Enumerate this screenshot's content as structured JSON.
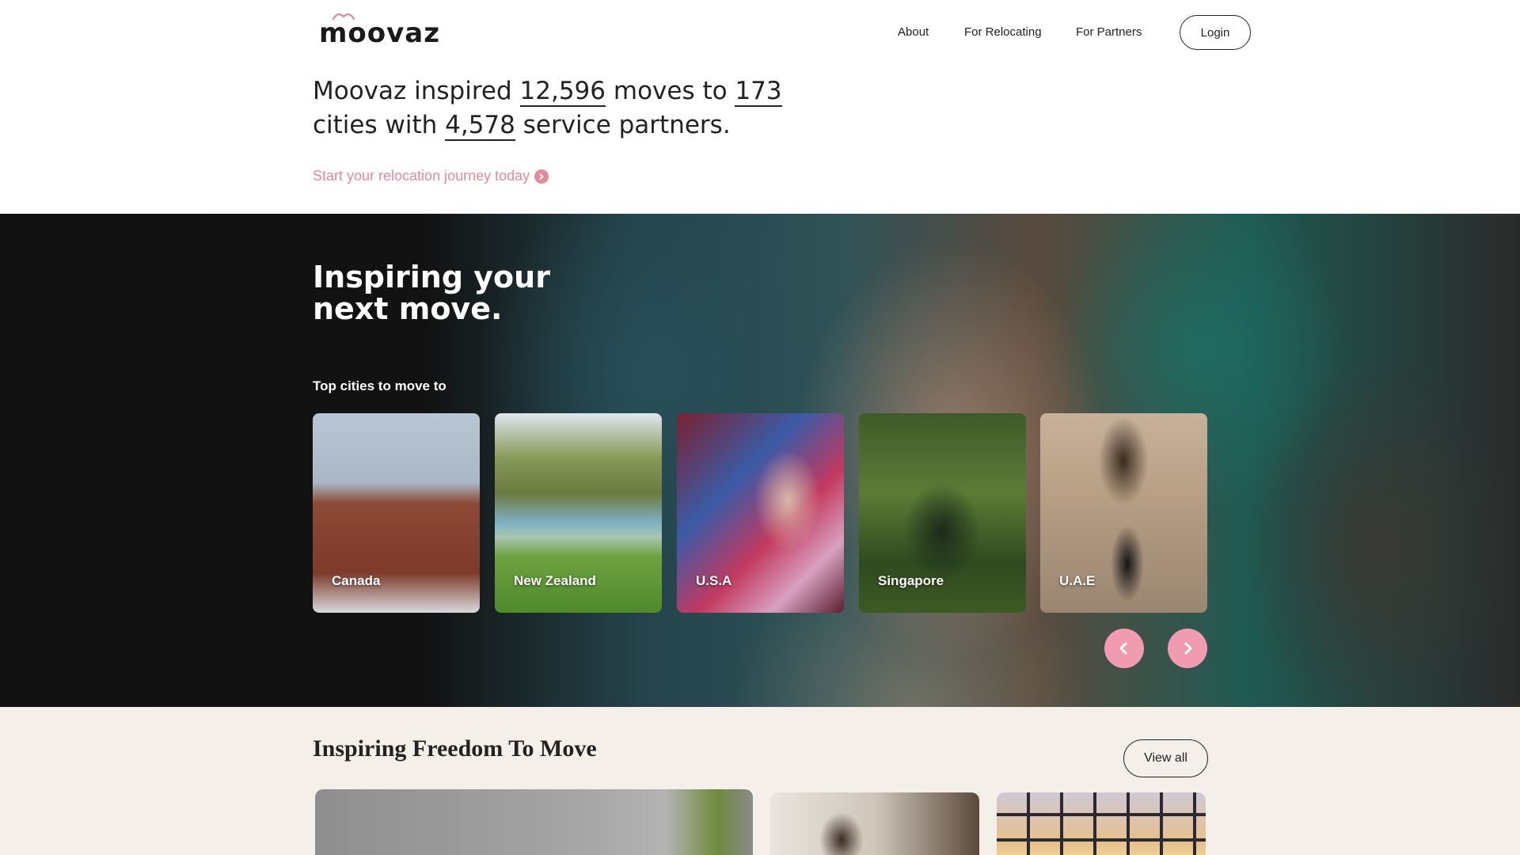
{
  "header": {
    "logo_text": "moovaz",
    "nav": [
      {
        "label": "About"
      },
      {
        "label": "For Relocating"
      },
      {
        "label": "For Partners"
      }
    ],
    "login_label": "Login"
  },
  "intro": {
    "part1": "Moovaz inspired ",
    "moves": "12,596",
    "part2": " moves to ",
    "cities": "173",
    "part3": " cities with ",
    "partners": "4,578",
    "part4": " service partners.",
    "cta_label": "Start your relocation journey today"
  },
  "hero": {
    "title": "Inspiring your next move.",
    "subtitle": "Top cities to move to",
    "cities": [
      {
        "name": "Canada"
      },
      {
        "name": "New Zealand"
      },
      {
        "name": "U.S.A"
      },
      {
        "name": "Singapore"
      },
      {
        "name": "U.A.E"
      }
    ],
    "icons": {
      "prev": "chevron-left-icon",
      "next": "chevron-right-icon",
      "cta": "arrow-circle-right-icon"
    }
  },
  "freedom": {
    "title": "Inspiring Freedom To Move",
    "view_all_label": "View all"
  },
  "colors": {
    "accent_pink": "#e48a9e",
    "button_pink": "#f19bb1",
    "section_bg": "#f5efea",
    "text": "#222222"
  }
}
